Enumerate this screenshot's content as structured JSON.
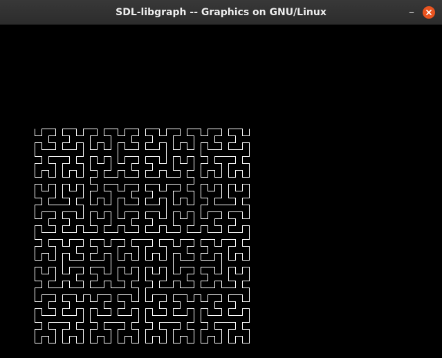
{
  "window": {
    "title": "SDL-libgraph -- Graphics on GNU/Linux",
    "minimize_symbol": "–",
    "close_icon": "close-icon",
    "accent_close": "#e95420"
  },
  "canvas": {
    "background": "#000000",
    "drawing": {
      "kind": "hilbert-curve",
      "order": 5,
      "stroke": "#ffffff"
    }
  }
}
